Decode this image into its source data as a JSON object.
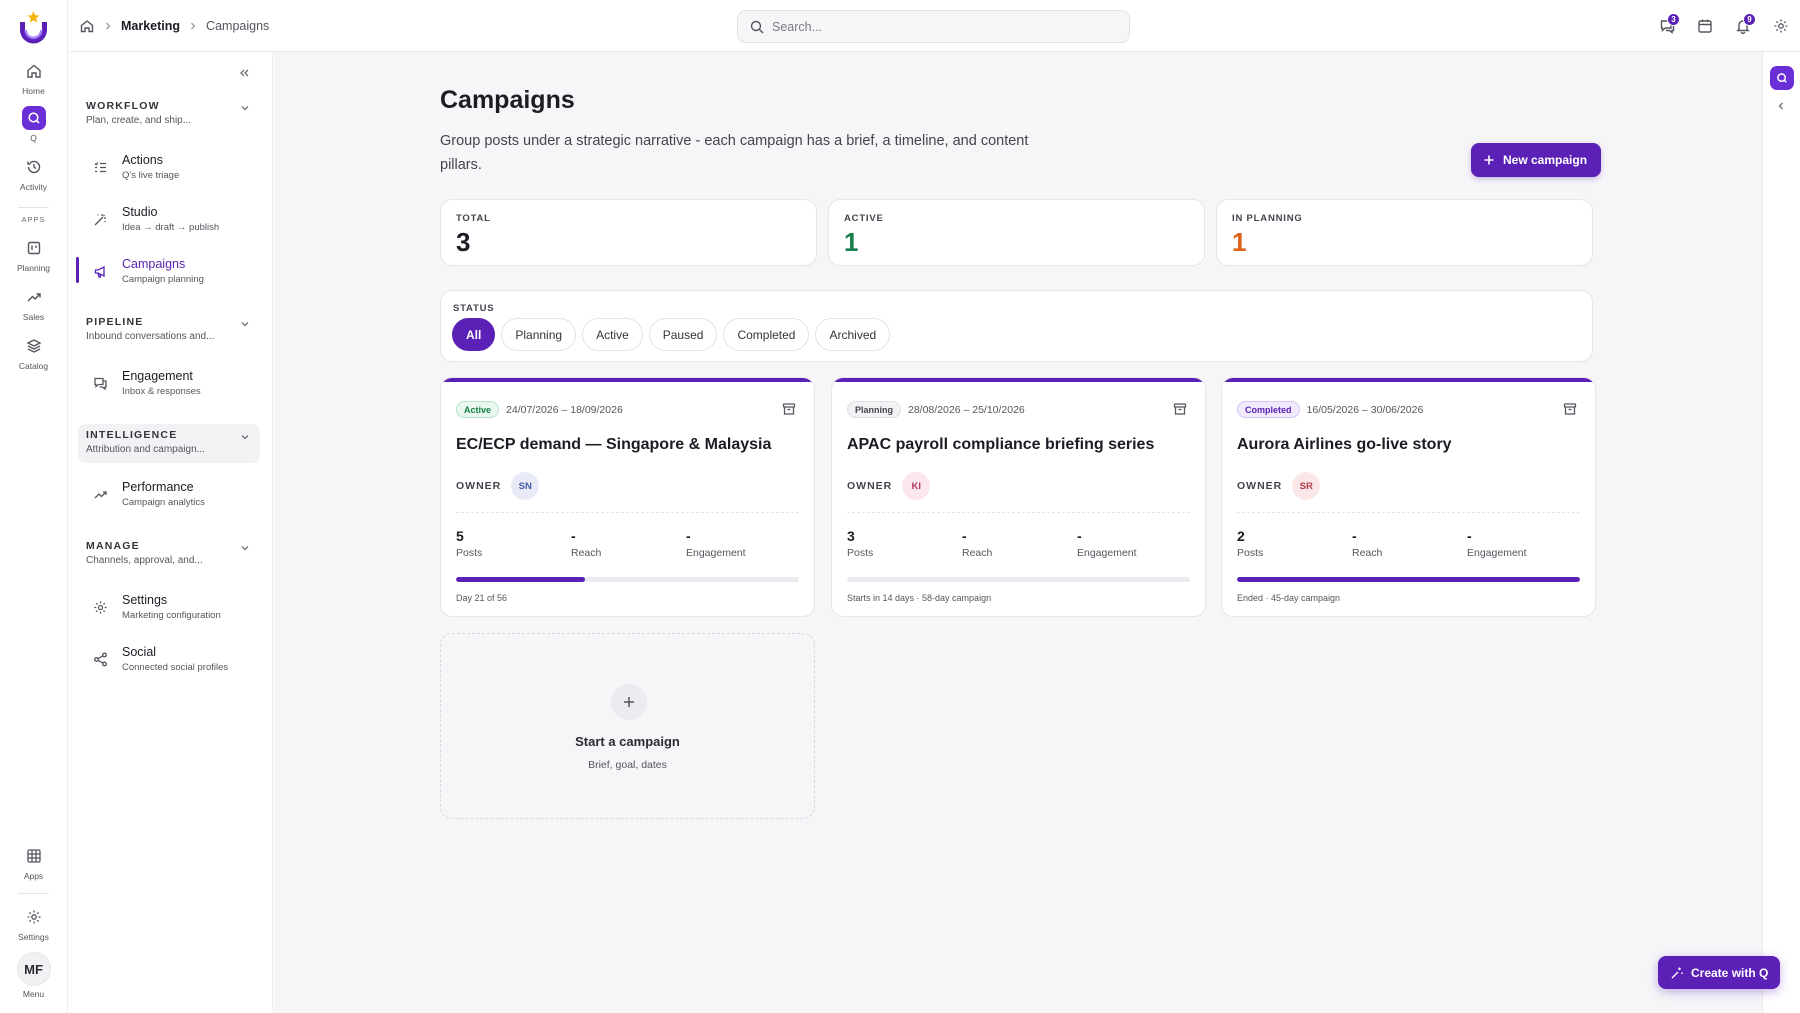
{
  "colors": {
    "brand": "#5b21b6",
    "active_green": "#17804a",
    "planning_orange": "#e0611a"
  },
  "rail": {
    "items": [
      {
        "label": "Home",
        "icon": "home-icon"
      },
      {
        "label": "Q",
        "icon": "q-icon"
      },
      {
        "label": "Activity",
        "icon": "history-icon"
      },
      {
        "label": "Planning",
        "icon": "planning-board-icon"
      },
      {
        "label": "Sales",
        "icon": "trend-up-icon"
      },
      {
        "label": "Catalog",
        "icon": "layers-icon"
      },
      {
        "label": "Apps",
        "icon": "grid-icon"
      },
      {
        "label": "Settings",
        "icon": "gear-icon"
      },
      {
        "label": "Menu",
        "icon": "avatar"
      }
    ],
    "section_apps": "APPS",
    "avatar_initials": "MF"
  },
  "topbar": {
    "breadcrumb": [
      "Marketing",
      "Campaigns"
    ],
    "search_placeholder": "Search...",
    "messages_badge": "3",
    "notifications_badge": "9"
  },
  "sidenav": {
    "groups": [
      {
        "title": "WORKFLOW",
        "subtitle": "Plan, create, and ship..."
      },
      {
        "title": "PIPELINE",
        "subtitle": "Inbound conversations and..."
      },
      {
        "title": "INTELLIGENCE",
        "subtitle": "Attribution and campaign..."
      },
      {
        "title": "MANAGE",
        "subtitle": "Channels, approval, and..."
      }
    ],
    "items": [
      {
        "title": "Actions",
        "subtitle": "Q's live triage",
        "icon": "checklist-icon"
      },
      {
        "title": "Studio",
        "subtitle": "Idea → draft → publish",
        "icon": "magic-wand-icon"
      },
      {
        "title": "Campaigns",
        "subtitle": "Campaign planning",
        "icon": "megaphone-icon"
      },
      {
        "title": "Engagement",
        "subtitle": "Inbox & responses",
        "icon": "chat-icon"
      },
      {
        "title": "Performance",
        "subtitle": "Campaign analytics",
        "icon": "trend-up-icon"
      },
      {
        "title": "Settings",
        "subtitle": "Marketing configuration",
        "icon": "gear-icon"
      },
      {
        "title": "Social",
        "subtitle": "Connected social profiles",
        "icon": "share-icon"
      }
    ]
  },
  "main": {
    "title": "Campaigns",
    "description": "Group posts under a strategic narrative - each campaign has a brief, a timeline, and content pillars.",
    "new_button": "New campaign",
    "stats": [
      {
        "label": "TOTAL",
        "value": "3",
        "color": "#1c1c24"
      },
      {
        "label": "ACTIVE",
        "value": "1",
        "color": "#17804a"
      },
      {
        "label": "IN PLANNING",
        "value": "1",
        "color": "#e0611a"
      }
    ],
    "filter": {
      "label": "STATUS",
      "chips": [
        "All",
        "Planning",
        "Active",
        "Paused",
        "Completed",
        "Archived"
      ],
      "selected": "All"
    },
    "owner_label": "OWNER",
    "metric_labels": [
      "Posts",
      "Reach",
      "Engagement"
    ],
    "campaigns": [
      {
        "status": "Active",
        "status_bg": "#e9f7ef",
        "status_fg": "#17804a",
        "status_border": "#b8e3c9",
        "dates": "24/07/2026 – 18/09/2026",
        "title": "EC/ECP demand — Singapore & Malaysia",
        "owner": "SN",
        "owner_bg": "#e8ebf7",
        "owner_fg": "#4a5aa8",
        "posts": "5",
        "reach": "-",
        "engagement": "-",
        "progress": 0.375,
        "note": "Day 21 of 56"
      },
      {
        "status": "Planning",
        "status_bg": "#f3f3f5",
        "status_fg": "#44444e",
        "status_border": "#dedee4",
        "dates": "28/08/2026 – 25/10/2026",
        "title": "APAC payroll compliance briefing series",
        "owner": "KI",
        "owner_bg": "#fbe6ee",
        "owner_fg": "#b23a68",
        "posts": "3",
        "reach": "-",
        "engagement": "-",
        "progress": 0,
        "note": "Starts in 14 days · 58-day campaign"
      },
      {
        "status": "Completed",
        "status_bg": "#f1eafc",
        "status_fg": "#5b21b6",
        "status_border": "#d7c6f4",
        "dates": "16/05/2026 – 30/06/2026",
        "title": "Aurora Airlines go-live story",
        "owner": "SR",
        "owner_bg": "#fbe6e8",
        "owner_fg": "#b23a4a",
        "posts": "2",
        "reach": "-",
        "engagement": "-",
        "progress": 1,
        "note": "Ended · 45-day campaign"
      }
    ],
    "start_card": {
      "title": "Start a campaign",
      "subtitle": "Brief, goal, dates"
    }
  },
  "right_rail": {
    "create_button": "Create with Q"
  }
}
